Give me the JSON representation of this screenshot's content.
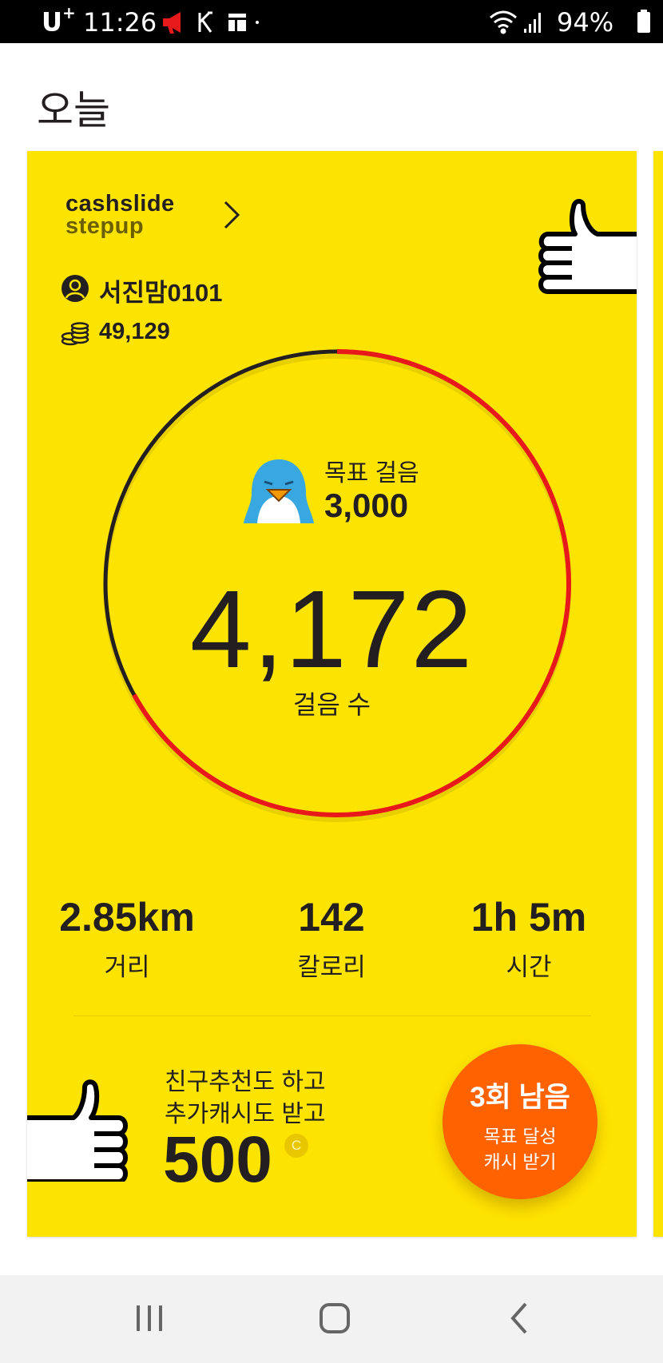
{
  "status_bar": {
    "carrier": "U",
    "carrier_sup": "+",
    "time": "11:26",
    "battery": "94%"
  },
  "page": {
    "title": "오늘"
  },
  "card": {
    "logo_line1": "cashslide",
    "logo_line2": "stepup",
    "user_name": "서진맘0101",
    "cash_balance": "49,129",
    "goal_label": "목표 걸음",
    "goal_value": "3,000",
    "steps_value": "4,172",
    "steps_label": "걸음 수",
    "progress_fraction": 1.0,
    "stats": [
      {
        "value": "2.85km",
        "label": "거리"
      },
      {
        "value": "142",
        "label": "칼로리"
      },
      {
        "value": "1h 5m",
        "label": "시간"
      }
    ],
    "promo_line1": "친구추천도 하고",
    "promo_line2": "추가캐시도 받고",
    "promo_amount": "500",
    "promo_coin": "C",
    "cta_title": "3회 남음",
    "cta_sub1": "목표 달성",
    "cta_sub2": "캐시 받기"
  },
  "colors": {
    "card_bg": "#fde400",
    "ring_dark": "#231f20",
    "ring_red": "#e8191b",
    "cta": "#ff6200",
    "status_bar": "#000000"
  },
  "icons": [
    "back-icon",
    "home-icon",
    "recent-apps-icon",
    "chevron-right-icon",
    "user-icon",
    "coins-icon",
    "thumbs-up-icon",
    "penguin-icon"
  ]
}
